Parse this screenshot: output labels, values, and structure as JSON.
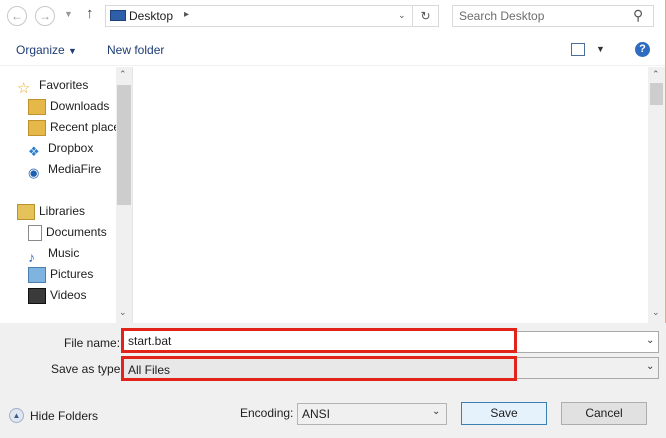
{
  "address": {
    "location": "Desktop",
    "search_placeholder": "Search Desktop"
  },
  "toolbar": {
    "organize": "Organize",
    "new_folder": "New folder"
  },
  "nav": {
    "favorites_label": "Favorites",
    "favorites": [
      "Downloads",
      "Recent place",
      "Dropbox",
      "MediaFire"
    ],
    "libraries_label": "Libraries",
    "libraries": [
      "Documents",
      "Music",
      "Pictures",
      "Videos"
    ]
  },
  "form": {
    "file_name_label": "File name:",
    "file_name_value": "start.bat",
    "save_type_label": "Save as type:",
    "save_type_value": "All Files"
  },
  "footer": {
    "hide_folders": "Hide Folders",
    "encoding_label": "Encoding:",
    "encoding_value": "ANSI",
    "save": "Save",
    "cancel": "Cancel"
  },
  "colors": {
    "highlight_box": "#e2231a",
    "link_text": "#1e3c74"
  }
}
